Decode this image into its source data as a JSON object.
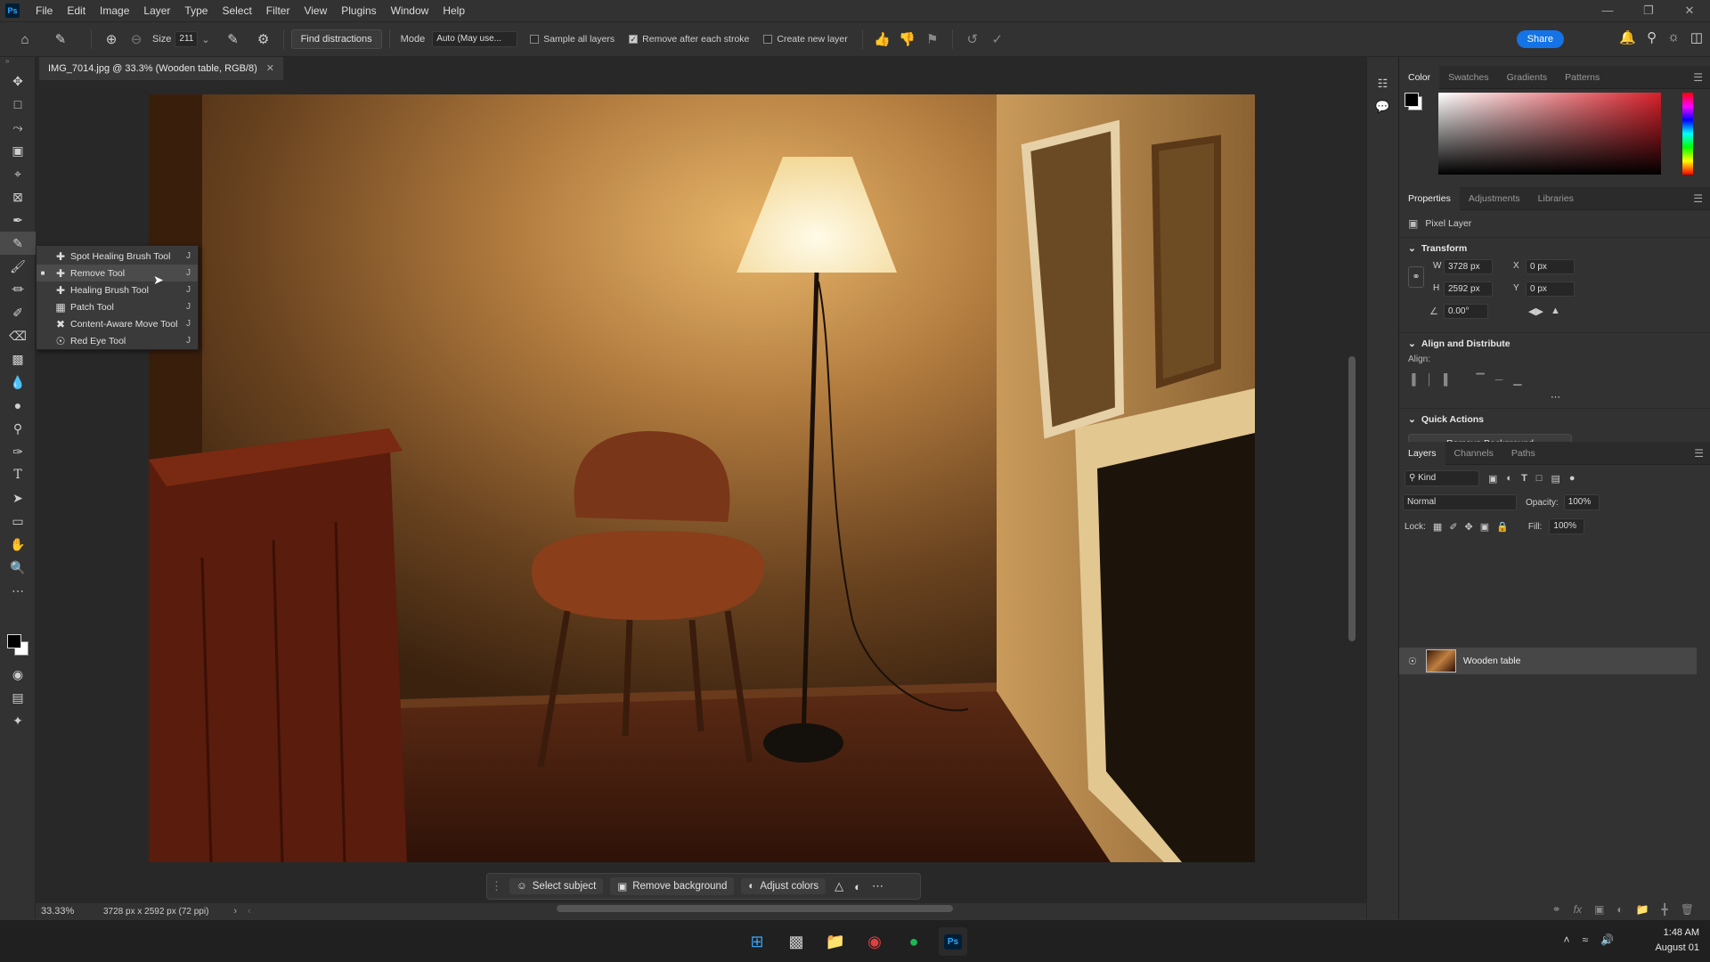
{
  "menubar": {
    "items": [
      "File",
      "Edit",
      "Image",
      "Layer",
      "Type",
      "Select",
      "Filter",
      "View",
      "Plugins",
      "Window",
      "Help"
    ]
  },
  "options": {
    "size_label": "Size",
    "size_value": "211",
    "find_distractions": "Find distractions",
    "mode_label": "Mode",
    "mode_value": "Auto (May use...",
    "sample_all_layers": "Sample all layers",
    "remove_after_stroke": "Remove after each stroke",
    "create_new_layer": "Create new layer",
    "share": "Share"
  },
  "document": {
    "tab_title": "IMG_7014.jpg @ 33.3% (Wooden table, RGB/8)"
  },
  "flyout": {
    "items": [
      {
        "label": "Spot Healing Brush Tool",
        "key": "J",
        "icon": "bandage-icon"
      },
      {
        "label": "Remove Tool",
        "key": "J",
        "icon": "remove-brush-icon"
      },
      {
        "label": "Healing Brush Tool",
        "key": "J",
        "icon": "healing-brush-icon"
      },
      {
        "label": "Patch Tool",
        "key": "J",
        "icon": "patch-icon"
      },
      {
        "label": "Content-Aware Move Tool",
        "key": "J",
        "icon": "move-arrows-icon"
      },
      {
        "label": "Red Eye Tool",
        "key": "J",
        "icon": "eye-icon"
      }
    ]
  },
  "context_bar": {
    "select_subject": "Select subject",
    "remove_background": "Remove background",
    "adjust_colors": "Adjust colors"
  },
  "status": {
    "zoom": "33.33%",
    "doc_info": "3728 px x 2592 px (72 ppi)"
  },
  "color_panel": {
    "tabs": [
      "Color",
      "Swatches",
      "Gradients",
      "Patterns"
    ]
  },
  "properties_panel": {
    "tabs": [
      "Properties",
      "Adjustments",
      "Libraries"
    ],
    "layer_type": "Pixel Layer",
    "transform_title": "Transform",
    "w_label": "W",
    "w_value": "3728 px",
    "h_label": "H",
    "h_value": "2592 px",
    "x_label": "X",
    "x_value": "0 px",
    "y_label": "Y",
    "y_value": "0 px",
    "angle_value": "0.00°",
    "align_title": "Align and Distribute",
    "align_label": "Align:",
    "quick_actions_title": "Quick Actions",
    "remove_background_btn": "Remove Background"
  },
  "layers_panel": {
    "tabs": [
      "Layers",
      "Channels",
      "Paths"
    ],
    "kind": "Kind",
    "blend_mode": "Normal",
    "opacity_label": "Opacity:",
    "opacity_value": "100%",
    "lock_label": "Lock:",
    "fill_label": "Fill:",
    "fill_value": "100%",
    "layer_name": "Wooden table"
  },
  "taskbar": {
    "time": "1:48 AM",
    "date": "August 01"
  }
}
